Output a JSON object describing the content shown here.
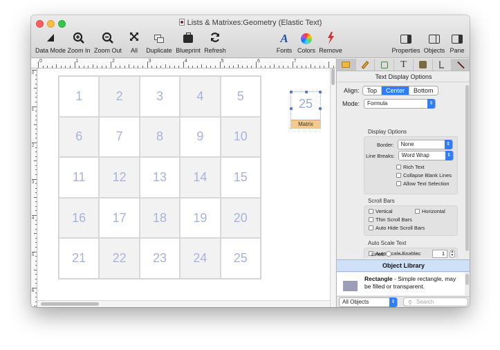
{
  "window": {
    "title": "Lists & Matrixes:Geometry (Elastic Text)"
  },
  "toolbar": {
    "items": [
      {
        "label": "Data Mode",
        "icon": "data-mode-icon"
      },
      {
        "label": "Zoom In",
        "icon": "zoom-in-icon"
      },
      {
        "label": "Zoom Out",
        "icon": "zoom-out-icon"
      },
      {
        "label": "All",
        "icon": "fit-all-icon"
      },
      {
        "label": "Duplicate",
        "icon": "duplicate-icon"
      },
      {
        "label": "Blueprint",
        "icon": "blueprint-icon"
      },
      {
        "label": "Refresh",
        "icon": "refresh-icon"
      },
      {
        "label": "Fonts",
        "icon": "fonts-icon"
      },
      {
        "label": "Colors",
        "icon": "colors-icon"
      },
      {
        "label": "Remove",
        "icon": "remove-icon"
      },
      {
        "label": "Properties",
        "icon": "properties-icon"
      },
      {
        "label": "Objects",
        "icon": "objects-icon"
      },
      {
        "label": "Pane",
        "icon": "pane-icon"
      }
    ]
  },
  "ruler": {
    "horizontal_labels": [
      "0",
      "1",
      "2",
      "3",
      "4",
      "5",
      "6",
      "7"
    ],
    "vertical_labels": [
      "0",
      "1",
      "2",
      "3",
      "4",
      "5",
      "6"
    ]
  },
  "matrix": {
    "cells": [
      "1",
      "2",
      "3",
      "4",
      "5",
      "6",
      "7",
      "8",
      "9",
      "10",
      "11",
      "12",
      "13",
      "14",
      "15",
      "16",
      "17",
      "18",
      "19",
      "20",
      "21",
      "22",
      "23",
      "24",
      "25"
    ],
    "object_value": "25",
    "object_label": "Matrix"
  },
  "panel": {
    "tool_tabs": [
      "text-display-icon",
      "pencil-icon",
      "binding-icon",
      "text-icon",
      "formula-icon",
      "action-icon",
      "line-icon"
    ],
    "header": "Text Display Options",
    "align": {
      "label": "Align:",
      "options": [
        "Top",
        "Center",
        "Bottom"
      ],
      "selected": "Center"
    },
    "mode": {
      "label": "Mode:",
      "value": "Formula"
    },
    "display_options": {
      "title": "Display Options",
      "border_label": "Border:",
      "border_value": "None",
      "line_breaks_label": "Line Breaks:",
      "line_breaks_value": "Word Wrap",
      "rich_text": "Rich Text",
      "collapse_blank_lines": "Collapse Blank Lines",
      "allow_text_selection": "Allow Text Selection"
    },
    "scroll_bars": {
      "title": "Scroll Bars",
      "vertical": "Vertical",
      "horizontal": "Horizontal",
      "thin": "Thin Scroll Bars",
      "auto_hide": "Auto Hide Scroll Bars"
    },
    "auto_scale": {
      "title": "Auto Scale Text",
      "enabled": "Auto Scale Enablec",
      "lines_label": "Lines:",
      "lines_value": "1"
    }
  },
  "library": {
    "header": "Object Library",
    "item_name": "Rectangle",
    "item_desc": " - Simple rectangle, may be filled or transparent.",
    "filter": "All Objects",
    "search_placeholder": "Search"
  },
  "colors": {
    "accent": "#2f7ef6",
    "cell_text": "#a8b3dc",
    "matrix_tag": "#f3c98c",
    "library_header": "#cfe1f7"
  }
}
